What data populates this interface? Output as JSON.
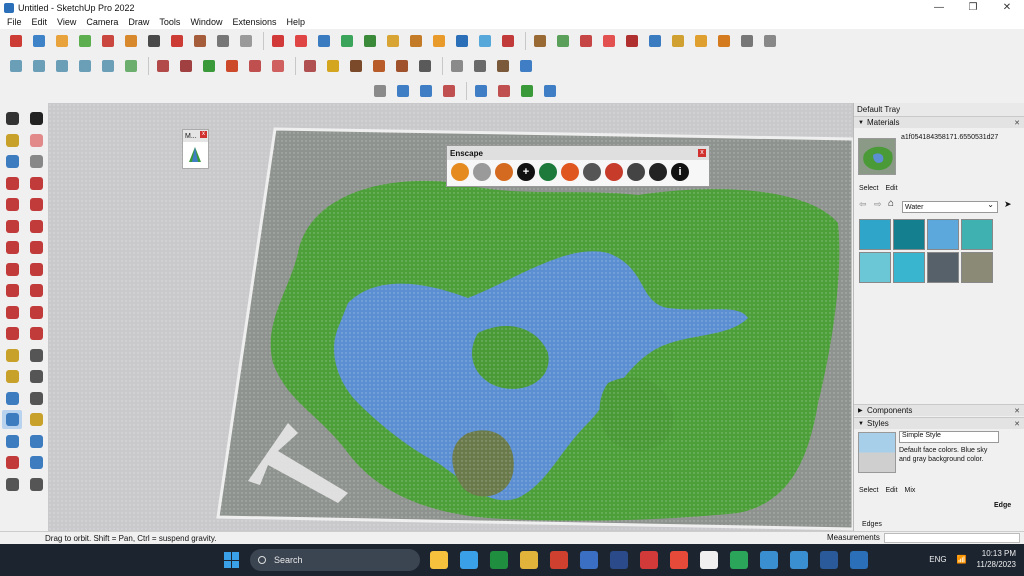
{
  "window": {
    "title": "Untitled - SketchUp Pro 2022",
    "minimize": "—",
    "maximize": "❐",
    "close": "✕"
  },
  "menu": [
    "File",
    "Edit",
    "View",
    "Camera",
    "Draw",
    "Tools",
    "Window",
    "Extensions",
    "Help"
  ],
  "toolbar_row1_colors": [
    "#cc3b34",
    "#3e82c7",
    "#e8a33d",
    "#5cae4e",
    "#c9473f",
    "#d8892d",
    "#4a4a4a",
    "#cc3b34",
    "#a55c3a",
    "#777",
    "#9a9a9a",
    "#d23a3a",
    "#e04545",
    "#3b7bc0",
    "#3aa55a",
    "#3a8a3a",
    "#d8a534",
    "#c47b28",
    "#e89a2a",
    "#2a6fb8",
    "#55a8d9",
    "#c23b3b",
    "#9a6a35",
    "#5aa05a",
    "#c64646",
    "#e25050",
    "#b03030",
    "#3b7bc0",
    "#d0a030",
    "#e0a030",
    "#d47a1f",
    "#777",
    "#888"
  ],
  "toolbar_row2_colors": [
    "#6b9fb8",
    "#6b9fb8",
    "#6b9fb8",
    "#6b9fb8",
    "#6b9fb8",
    "#6bae6e",
    "#b34a4a",
    "#a04040",
    "#3a9a3a",
    "#cc4a2a",
    "#c05050",
    "#d06060",
    "#b05050",
    "#d4a51f",
    "#7a4a2a",
    "#b85c2a",
    "#a0522d",
    "#5a5a5a",
    "#8a8a8a",
    "#6a6a6a",
    "#7a5a3a",
    "#3f7ec4"
  ],
  "toolbar_row3_colors": [
    "#8a8a8a",
    "#3f7ec4",
    "#3f7ec4",
    "#c05050",
    "#3f7ec4",
    "#c05050",
    "#3a9a3a",
    "#3f7ec4"
  ],
  "left_tools": [
    {
      "name": "select-icon",
      "color": "#333"
    },
    {
      "name": "orbit-icon",
      "color": "#222"
    },
    {
      "name": "paint-bucket-icon",
      "color": "#c8a12a"
    },
    {
      "name": "eraser-icon",
      "color": "#e28a8a"
    },
    {
      "name": "lasso-icon",
      "color": "#3c7cbf"
    },
    {
      "name": "tag-icon",
      "color": "#888"
    },
    {
      "name": "line-icon",
      "color": "#c23b3b"
    },
    {
      "name": "freehand-icon",
      "color": "#c23b3b"
    },
    {
      "name": "rectangle-icon",
      "color": "#c23b3b"
    },
    {
      "name": "rotated-rect-icon",
      "color": "#c23b3b"
    },
    {
      "name": "circle-icon",
      "color": "#c23b3b"
    },
    {
      "name": "polygon-icon",
      "color": "#c23b3b"
    },
    {
      "name": "arc-icon",
      "color": "#c23b3b"
    },
    {
      "name": "arc2-icon",
      "color": "#c23b3b"
    },
    {
      "name": "arc3-icon",
      "color": "#c23b3b"
    },
    {
      "name": "pie-icon",
      "color": "#c23b3b"
    },
    {
      "name": "move-icon",
      "color": "#c23b3b"
    },
    {
      "name": "pushpull-icon",
      "color": "#c23b3b"
    },
    {
      "name": "rotate-icon",
      "color": "#c23b3b"
    },
    {
      "name": "followme-icon",
      "color": "#c23b3b"
    },
    {
      "name": "scale-icon",
      "color": "#c23b3b"
    },
    {
      "name": "offset-icon",
      "color": "#c23b3b"
    },
    {
      "name": "tape-icon",
      "color": "#c8a12a"
    },
    {
      "name": "dimension-icon",
      "color": "#555"
    },
    {
      "name": "protractor-icon",
      "color": "#c8a12a"
    },
    {
      "name": "text-icon",
      "color": "#555"
    },
    {
      "name": "axes-icon",
      "color": "#3c7cbf"
    },
    {
      "name": "3dtext-icon",
      "color": "#555"
    },
    {
      "name": "orbit-tool-icon",
      "color": "#3c7cbf"
    },
    {
      "name": "pan-icon",
      "color": "#c8a12a"
    },
    {
      "name": "zoom-icon",
      "color": "#3c7cbf"
    },
    {
      "name": "zoom-window-icon",
      "color": "#3c7cbf"
    },
    {
      "name": "zoom-extents-icon",
      "color": "#c23b3b"
    },
    {
      "name": "previous-view-icon",
      "color": "#3c7cbf"
    },
    {
      "name": "walk-icon",
      "color": "#555"
    },
    {
      "name": "lookaround-icon",
      "color": "#555"
    }
  ],
  "mini_panel": {
    "title": "M...",
    "close": "x"
  },
  "enscape": {
    "title": "Enscape",
    "close": "x",
    "buttons": [
      {
        "name": "enscape-start-icon",
        "color": "#e58a1f",
        "glyph": ""
      },
      {
        "name": "enscape-sync-icon",
        "color": "#9a9a9a",
        "glyph": ""
      },
      {
        "name": "enscape-views-icon",
        "color": "#d46a1f",
        "glyph": ""
      },
      {
        "name": "enscape-add-icon",
        "color": "#111",
        "glyph": "+"
      },
      {
        "name": "enscape-asset-icon",
        "color": "#1d7a3a",
        "glyph": ""
      },
      {
        "name": "enscape-capture-icon",
        "color": "#e0561f",
        "glyph": ""
      },
      {
        "name": "enscape-checker-icon",
        "color": "#555",
        "glyph": ""
      },
      {
        "name": "enscape-upload-icon",
        "color": "#c73b2b",
        "glyph": ""
      },
      {
        "name": "enscape-settings-icon",
        "color": "#444",
        "glyph": ""
      },
      {
        "name": "enscape-feedback-icon",
        "color": "#222",
        "glyph": ""
      },
      {
        "name": "enscape-info-icon",
        "color": "#111",
        "glyph": "i"
      }
    ]
  },
  "tray": {
    "title": "Default Tray",
    "materials": {
      "label": "Materials",
      "name": "a1f054184358171.6550531d27",
      "select": "Select",
      "edit": "Edit",
      "library": "Water",
      "swatches": [
        "#2fa6c9",
        "#14808f",
        "#5ca7dc",
        "#3fb1b0",
        "#6bc7d6",
        "#3ab5cf",
        "#56616a",
        "#8a8a76"
      ]
    },
    "components": {
      "label": "Components"
    },
    "styles": {
      "label": "Styles",
      "name": "Simple Style",
      "desc": "Default face colors. Blue sky and gray background color.",
      "select": "Select",
      "edit": "Edit",
      "mix": "Mix",
      "edge": "Edge",
      "edges_check": "Edges"
    }
  },
  "statusbar": {
    "text": "Drag to orbit. Shift = Pan, Ctrl = suspend gravity.",
    "measurements": "Measurements"
  },
  "taskbar": {
    "search": "Search",
    "apps": [
      "#f6c13d",
      "#3aa0e8",
      "#1f8f3f",
      "#e2b33a",
      "#d0402e",
      "#3a6fc4",
      "#2a4a8a",
      "#d23a3a",
      "#e84a3a",
      "#f0f0f0",
      "#2aa55a",
      "#3a8fd0",
      "#3a8fd0",
      "#2a5a9a",
      "#2a6fb8"
    ],
    "lang": "ENG",
    "time": "10:13 PM",
    "date": "11/28/2023"
  }
}
